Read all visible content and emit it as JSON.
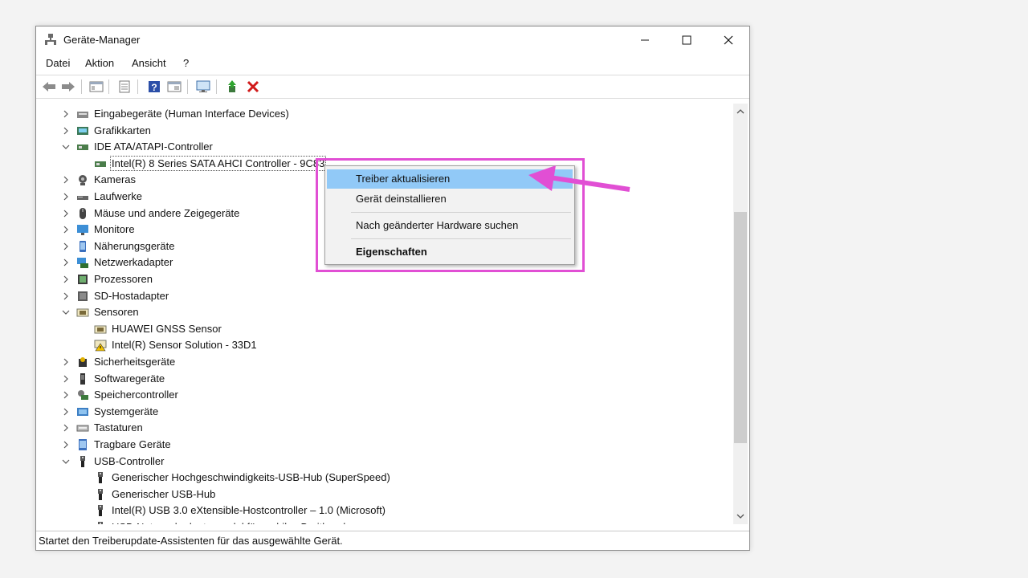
{
  "window": {
    "title": "Geräte-Manager",
    "controls": [
      "minimize",
      "maximize",
      "close"
    ]
  },
  "menubar": {
    "items": [
      "Datei",
      "Aktion",
      "Ansicht",
      "?"
    ]
  },
  "toolbar": {
    "icons": [
      "back-icon",
      "forward-icon",
      "view-devices-icon",
      "properties-icon",
      "help-icon",
      "view-icon",
      "monitor-scan-icon",
      "update-driver-icon",
      "uninstall-icon"
    ]
  },
  "tree": {
    "rows": [
      {
        "label": "Eingabegeräte (Human Interface Devices)",
        "icon": "hid-icon",
        "expander": "collapsed"
      },
      {
        "label": "Grafikkarten",
        "icon": "display-adapter-icon",
        "expander": "collapsed"
      },
      {
        "label": "IDE ATA/ATAPI-Controller",
        "icon": "ide-controller-icon",
        "expander": "expanded"
      },
      {
        "label": "Intel(R) 8 Series SATA AHCI Controller - 9C83",
        "icon": "controller-icon",
        "expander": "none",
        "child": true,
        "selected": true
      },
      {
        "label": "Kameras",
        "icon": "camera-icon",
        "expander": "collapsed"
      },
      {
        "label": "Laufwerke",
        "icon": "drive-icon",
        "expander": "collapsed"
      },
      {
        "label": "Mäuse und andere Zeigegeräte",
        "icon": "mouse-icon",
        "expander": "collapsed"
      },
      {
        "label": "Monitore",
        "icon": "monitor-icon",
        "expander": "collapsed"
      },
      {
        "label": "Näherungsgeräte",
        "icon": "proximity-icon",
        "expander": "collapsed"
      },
      {
        "label": "Netzwerkadapter",
        "icon": "network-icon",
        "expander": "collapsed"
      },
      {
        "label": "Prozessoren",
        "icon": "processor-icon",
        "expander": "collapsed"
      },
      {
        "label": "SD-Hostadapter",
        "icon": "sd-host-icon",
        "expander": "collapsed"
      },
      {
        "label": "Sensoren",
        "icon": "sensor-icon",
        "expander": "expanded"
      },
      {
        "label": "HUAWEI GNSS Sensor",
        "icon": "sensor-device-icon",
        "expander": "none",
        "child": true
      },
      {
        "label": "Intel(R) Sensor Solution - 33D1",
        "icon": "sensor-warning-icon",
        "expander": "none",
        "child": true
      },
      {
        "label": "Sicherheitsgeräte",
        "icon": "security-icon",
        "expander": "collapsed"
      },
      {
        "label": "Softwaregeräte",
        "icon": "software-device-icon",
        "expander": "collapsed"
      },
      {
        "label": "Speichercontroller",
        "icon": "storage-controller-icon",
        "expander": "collapsed"
      },
      {
        "label": "Systemgeräte",
        "icon": "system-device-icon",
        "expander": "collapsed"
      },
      {
        "label": "Tastaturen",
        "icon": "keyboard-icon",
        "expander": "collapsed"
      },
      {
        "label": "Tragbare Geräte",
        "icon": "portable-device-icon",
        "expander": "collapsed"
      },
      {
        "label": "USB-Controller",
        "icon": "usb-icon",
        "expander": "expanded"
      },
      {
        "label": "Generischer Hochgeschwindigkeits-USB-Hub (SuperSpeed)",
        "icon": "usb-icon",
        "expander": "none",
        "child": true
      },
      {
        "label": "Generischer USB-Hub",
        "icon": "usb-icon",
        "expander": "none",
        "child": true
      },
      {
        "label": "Intel(R) USB 3.0 eXtensible-Hostcontroller – 1.0 (Microsoft)",
        "icon": "usb-icon",
        "expander": "none",
        "child": true
      },
      {
        "label": "USB-Netzwerkadaptermodul für mobiles Breitband",
        "icon": "usb-icon",
        "expander": "none",
        "child": true
      }
    ]
  },
  "context_menu": {
    "items": [
      {
        "label": "Treiber aktualisieren",
        "highlighted": true
      },
      {
        "label": "Gerät deinstallieren"
      },
      {
        "label": "Nach geänderter Hardware suchen"
      },
      {
        "label": "Eigenschaften",
        "bold": true
      }
    ]
  },
  "statusbar": {
    "text": "Startet den Treiberupdate-Assistenten für das ausgewählte Gerät."
  },
  "annotation": {
    "highlight_color": "#e14fd4"
  }
}
